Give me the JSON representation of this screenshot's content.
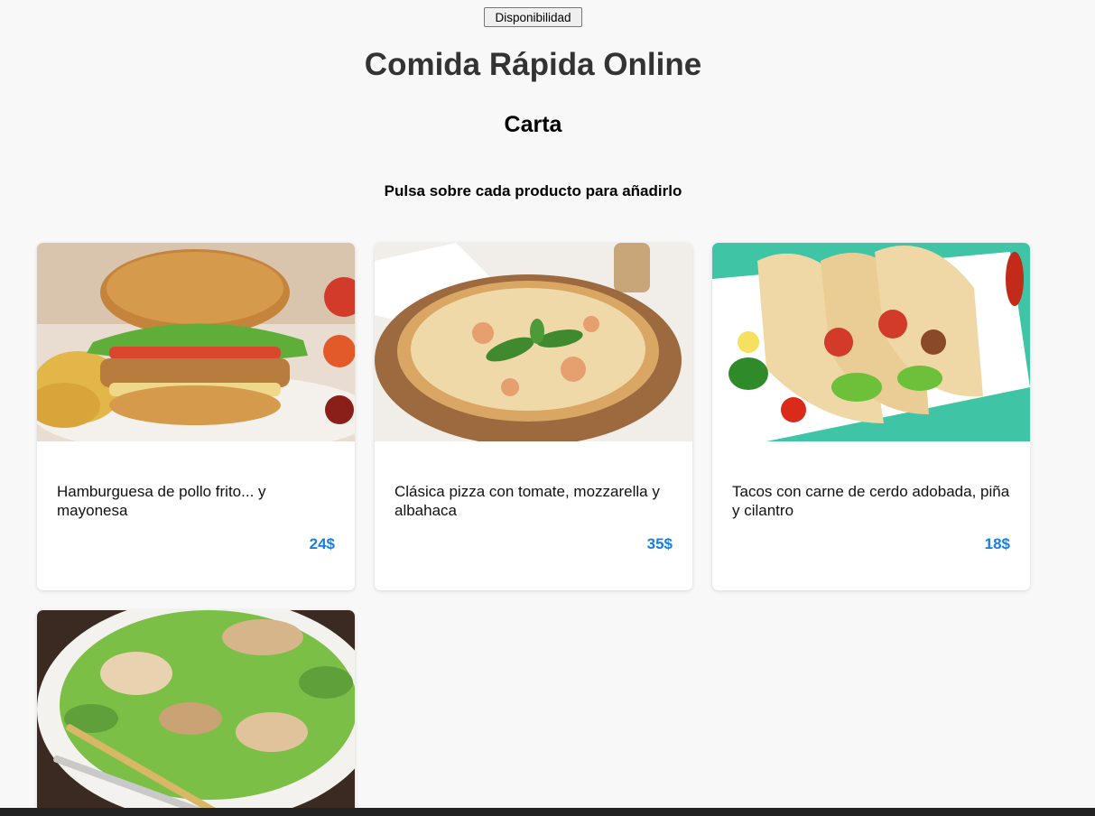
{
  "header": {
    "availability_button": "Disponibilidad",
    "title": "Comida Rápida Online",
    "subtitle": "Carta",
    "hint": "Pulsa sobre cada producto para añadirlo"
  },
  "products": [
    {
      "image_name": "burger-image",
      "description": "Hamburguesa de pollo frito... y mayonesa",
      "price": "24$"
    },
    {
      "image_name": "pizza-image",
      "description": "Clásica pizza con tomate, mozzarella y albahaca",
      "price": "35$"
    },
    {
      "image_name": "tacos-image",
      "description": "Tacos con carne de cerdo adobada, piña y cilantro",
      "price": "18$"
    },
    {
      "image_name": "salad-image",
      "description": "",
      "price": ""
    }
  ],
  "colors": {
    "background": "#f8f8f8",
    "price": "#1a7fe0",
    "card": "#ffffff"
  }
}
